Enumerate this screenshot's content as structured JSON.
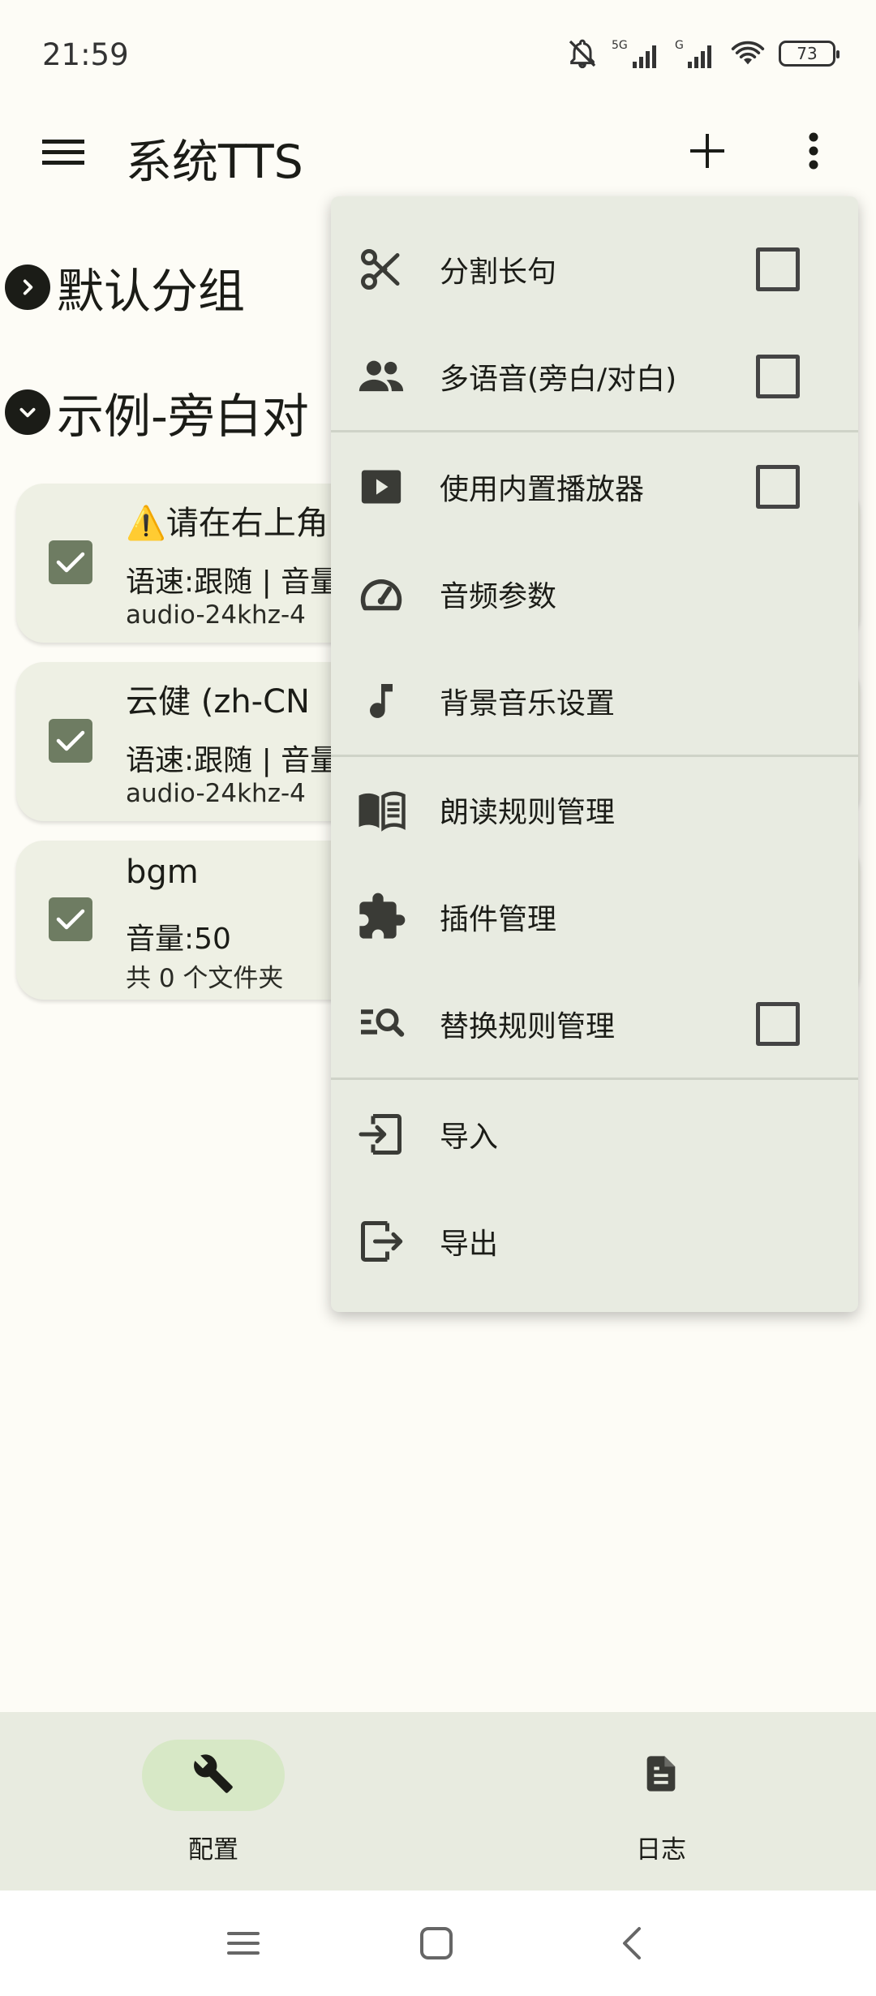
{
  "status_bar": {
    "time": "21:59",
    "battery": "73",
    "icons": [
      "bell-off-icon",
      "signal-5g-icon",
      "signal-g-icon",
      "wifi-icon",
      "battery-icon"
    ]
  },
  "app_bar": {
    "title": "系统TTS",
    "icons": [
      "menu-icon",
      "plus-icon",
      "more-vert-icon"
    ]
  },
  "groups": [
    {
      "title": "默认分组",
      "icon": "chevron-right-icon"
    },
    {
      "title": "示例-旁白对",
      "icon": "chevron-down-icon"
    }
  ],
  "cards": [
    {
      "title": "⚠️请在右上角",
      "line1": "语速:跟随 | 音量",
      "line2": "audio-24khz-4",
      "checked": true
    },
    {
      "title": "云健 (zh-CN",
      "line1": "语速:跟随 | 音量",
      "line2": "audio-24khz-4",
      "checked": true
    },
    {
      "title": "bgm",
      "line1": "音量:50",
      "line2": "共 0 个文件夹",
      "checked": true
    }
  ],
  "menu": {
    "items": [
      {
        "label": "分割长句",
        "icon": "scissors-icon",
        "has_checkbox": true,
        "checked": false
      },
      {
        "label": "多语音(旁白/对白)",
        "icon": "people-icon",
        "has_checkbox": true,
        "checked": false
      },
      {
        "label": "使用内置播放器",
        "icon": "play-box-icon",
        "has_checkbox": true,
        "checked": false
      },
      {
        "label": "音频参数",
        "icon": "speedometer-icon",
        "has_checkbox": false
      },
      {
        "label": "背景音乐设置",
        "icon": "music-note-icon",
        "has_checkbox": false
      },
      {
        "label": "朗读规则管理",
        "icon": "book-open-icon",
        "has_checkbox": false
      },
      {
        "label": "插件管理",
        "icon": "puzzle-icon",
        "has_checkbox": false
      },
      {
        "label": "替换规则管理",
        "icon": "find-replace-icon",
        "has_checkbox": true,
        "checked": false
      },
      {
        "label": "导入",
        "icon": "import-icon",
        "has_checkbox": false
      },
      {
        "label": "导出",
        "icon": "export-icon",
        "has_checkbox": false
      }
    ]
  },
  "bottom_nav": {
    "items": [
      {
        "label": "配置",
        "icon": "wrench-icon",
        "active": true
      },
      {
        "label": "日志",
        "icon": "document-icon",
        "active": false
      }
    ]
  },
  "system_nav": {
    "icons": [
      "recents-icon",
      "home-icon",
      "back-icon"
    ]
  },
  "colors": {
    "background": "#fdfcf6",
    "menu_background": "#e8ebe1",
    "card_background": "#eef0e4",
    "checkbox_fill": "#6e7c62",
    "nav_active_pill": "#d7e8c6",
    "text": "#1b1c17"
  }
}
